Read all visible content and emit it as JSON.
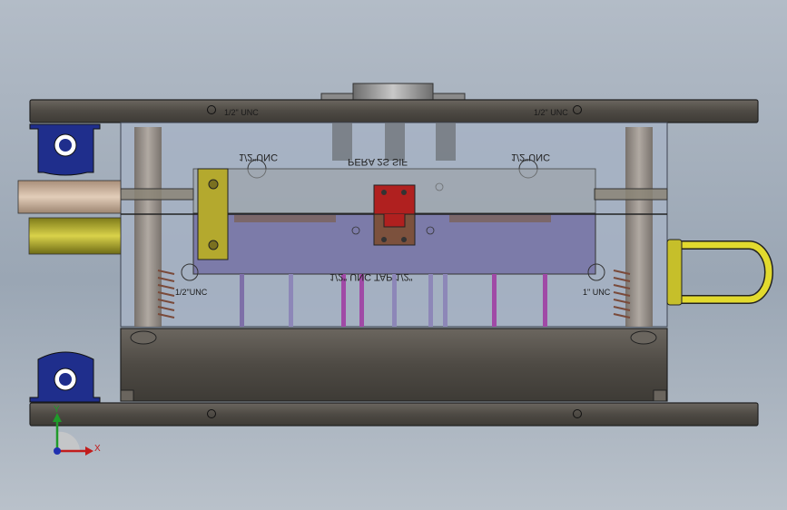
{
  "labels": {
    "top_left": "1/2\" UNC",
    "top_right": "1/2\" UNC",
    "mid_left_mirrored": "1/2\"UNC",
    "mid_right_mirrored": "1/2\"UNC",
    "center_mirrored": "PERA 2S SIF",
    "lower_left": "1/2\"UNC",
    "lower_right": "1\" UNC",
    "lower_center_mirrored": "1/2\" UNC TAP 1/2\""
  },
  "triad": {
    "x_label": "X",
    "y_label": "Y"
  },
  "colors": {
    "background_top": "#b3bcc7",
    "plate_dark": "#55514b",
    "glass": "#a7b3c6",
    "insert_purple": "#6f6aa0",
    "red_part": "#b0201f",
    "olive": "#b4a92e",
    "blue_bracket": "#1f2e8c",
    "yellow_handle": "#e2da2e"
  }
}
